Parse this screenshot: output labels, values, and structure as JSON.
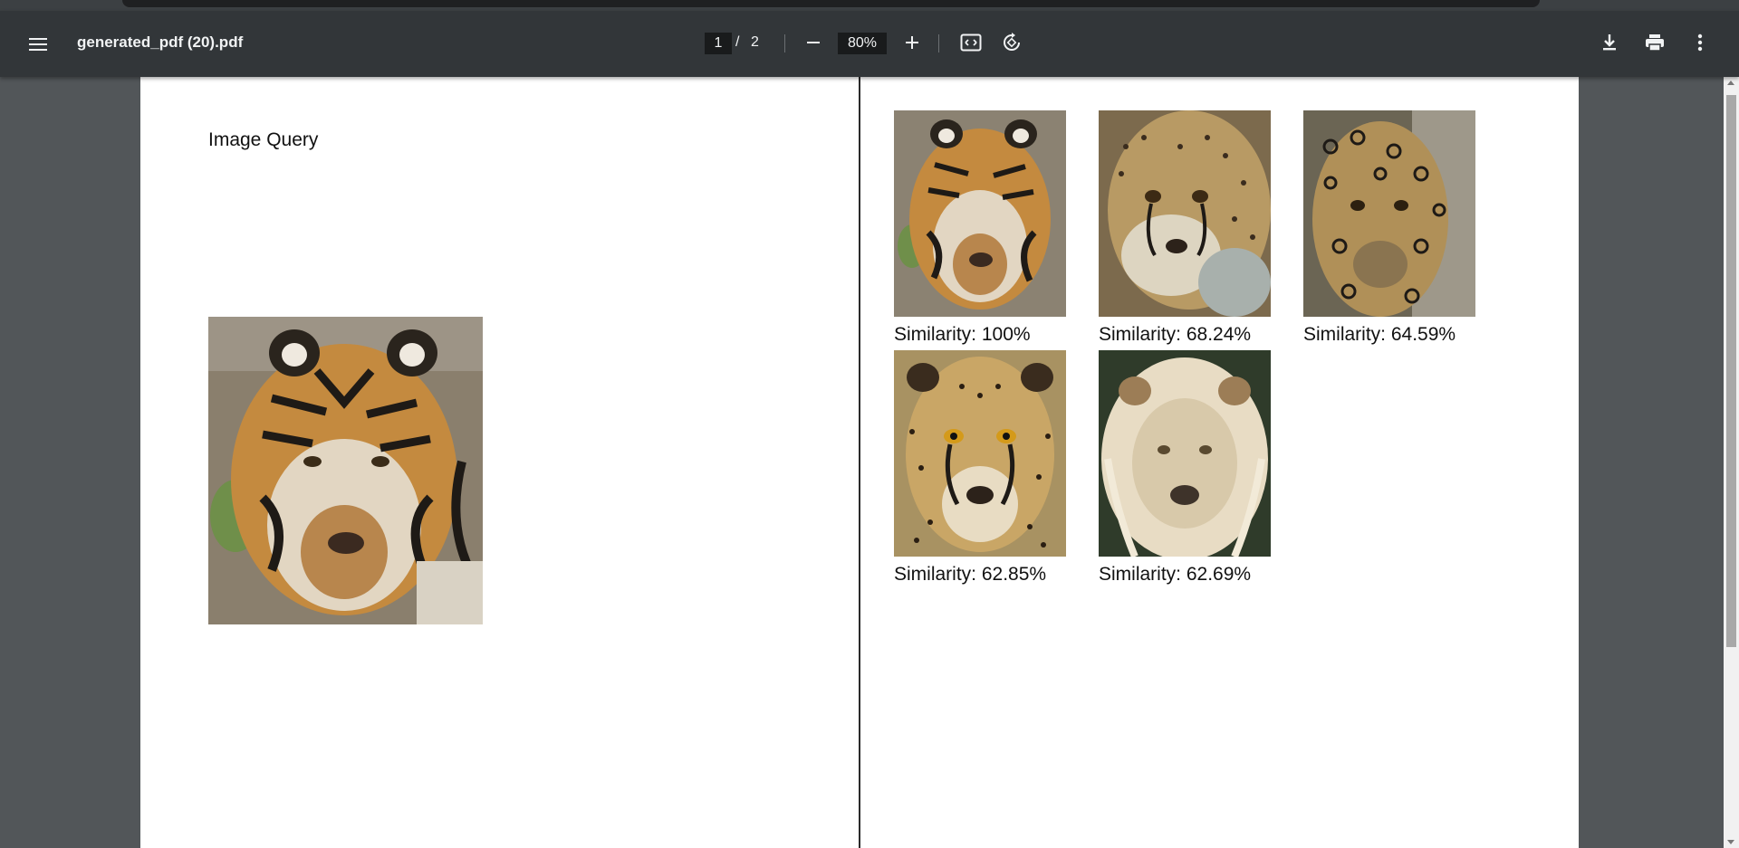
{
  "toolbar": {
    "title": "generated_pdf (20).pdf",
    "current_page": "1",
    "page_separator": "/",
    "total_pages": "2",
    "zoom": "80%"
  },
  "icons": {
    "menu": "menu-icon",
    "zoom_out": "minus-icon",
    "zoom_in": "plus-icon",
    "fit": "fit-to-page-icon",
    "rotate": "rotate-icon",
    "download": "download-icon",
    "print": "print-icon",
    "more": "more-vertical-icon"
  },
  "page1": {
    "heading": "Image Query",
    "query_image": "tiger"
  },
  "page2": {
    "results": [
      {
        "animal": "tiger",
        "label": "Similarity: 100%"
      },
      {
        "animal": "cheetah",
        "label": "Similarity: 68.24%"
      },
      {
        "animal": "jaguar",
        "label": "Similarity: 64.59%"
      },
      {
        "animal": "cheetah",
        "label": "Similarity: 62.85%"
      },
      {
        "animal": "white lion",
        "label": "Similarity: 62.69%"
      }
    ]
  },
  "colors": {
    "toolbar_bg": "#323639",
    "viewer_bg": "#525659",
    "page_bg": "#ffffff"
  }
}
